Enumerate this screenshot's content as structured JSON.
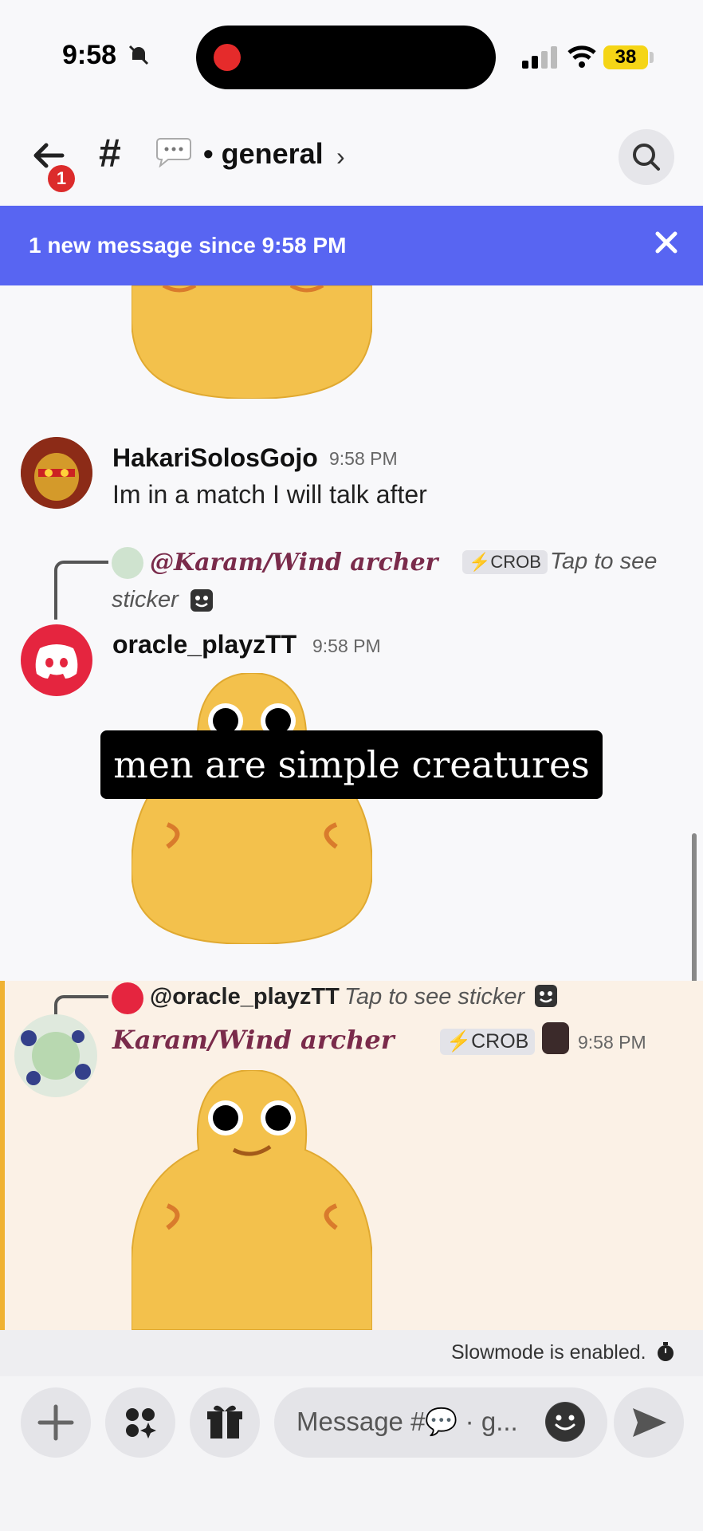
{
  "status_bar": {
    "time": "9:58",
    "battery": "38"
  },
  "header": {
    "hash": "#",
    "channel_name": "• general",
    "chevron": "›",
    "back_badge": "1"
  },
  "banner": {
    "text": "1 new message since 9:58 PM"
  },
  "messages": [
    {
      "username": "HakariSolosGojo",
      "timestamp": "9:58 PM",
      "text": "Im in a match I will talk after"
    },
    {
      "reply_to": "@Karam/Wind archer",
      "reply_tag": "⚡CROB",
      "reply_note_1": "Tap to see",
      "reply_note_2": "sticker",
      "username": "oracle_playzTT",
      "timestamp": "9:58 PM"
    },
    {
      "reply_to": "@oracle_playzTT",
      "reply_note": "Tap to see sticker",
      "username": "Karam/Wind archer",
      "tag": "⚡CROB",
      "timestamp": "9:58 PM"
    }
  ],
  "caption": "men are simple creatures",
  "slowmode": {
    "text": "Slowmode is enabled."
  },
  "composer": {
    "placeholder": "Message #💬 · g..."
  },
  "colors": {
    "banner": "#5865f2",
    "discord_red": "#e5253f",
    "highlight": "#fbf1e6",
    "highlight_bar": "#f0b232"
  }
}
